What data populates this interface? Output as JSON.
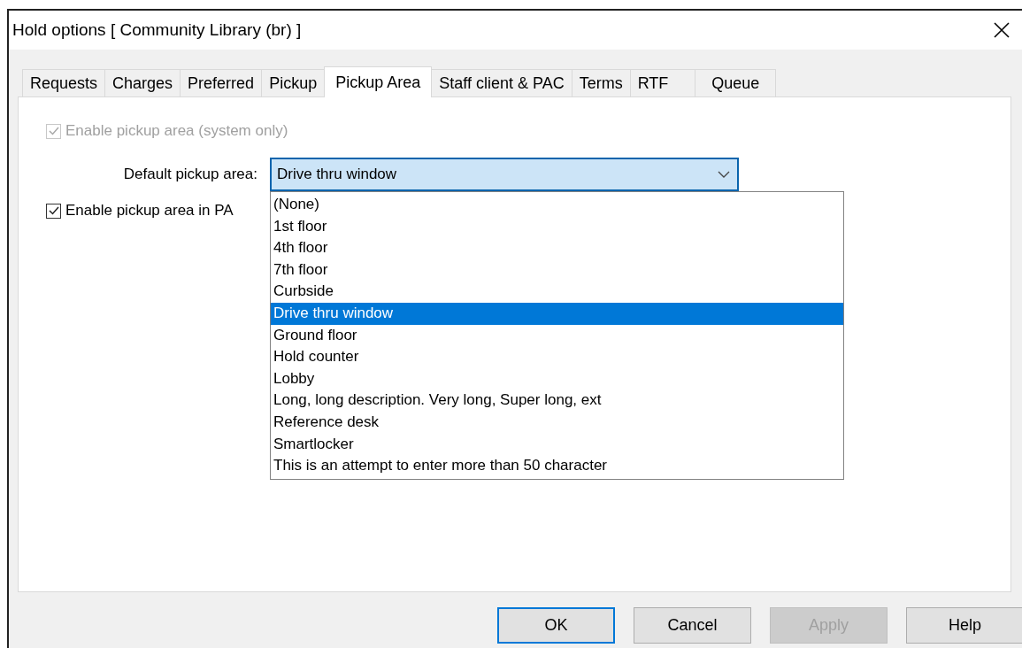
{
  "window": {
    "title": "Hold options [ Community Library  (br) ]"
  },
  "tabs": [
    {
      "label": "Requests",
      "selected": false
    },
    {
      "label": "Charges",
      "selected": false
    },
    {
      "label": "Preferred",
      "selected": false
    },
    {
      "label": "Pickup",
      "selected": false
    },
    {
      "label": "Pickup Area",
      "selected": true
    },
    {
      "label": "Staff client & PAC",
      "selected": false
    },
    {
      "label": "Terms",
      "selected": false
    },
    {
      "label": "RTF",
      "selected": false
    },
    {
      "label": "Queue",
      "selected": false
    }
  ],
  "enable_system": {
    "label": "Enable pickup area (system only)",
    "checked": true,
    "disabled": true
  },
  "default_pickup": {
    "label": "Default pickup area:",
    "value": "Drive thru window",
    "expanded": true,
    "options": [
      {
        "label": "(None)",
        "selected": false
      },
      {
        "label": "1st floor",
        "selected": false
      },
      {
        "label": "4th floor",
        "selected": false
      },
      {
        "label": "7th floor",
        "selected": false
      },
      {
        "label": "Curbside",
        "selected": false
      },
      {
        "label": "Drive thru window",
        "selected": true
      },
      {
        "label": "Ground floor",
        "selected": false
      },
      {
        "label": "Hold counter",
        "selected": false
      },
      {
        "label": "Lobby",
        "selected": false
      },
      {
        "label": "Long, long description. Very long, Super long, ext",
        "selected": false
      },
      {
        "label": "Reference desk",
        "selected": false
      },
      {
        "label": "Smartlocker",
        "selected": false
      },
      {
        "label": "This is an attempt to enter more than 50 character",
        "selected": false
      }
    ]
  },
  "enable_pac": {
    "label": "Enable pickup area in PA",
    "checked": true,
    "disabled": false
  },
  "buttons": [
    {
      "label": "OK",
      "default": true,
      "disabled": false
    },
    {
      "label": "Cancel",
      "default": false,
      "disabled": false
    },
    {
      "label": "Apply",
      "default": false,
      "disabled": true
    },
    {
      "label": "Help",
      "default": false,
      "disabled": false
    }
  ]
}
